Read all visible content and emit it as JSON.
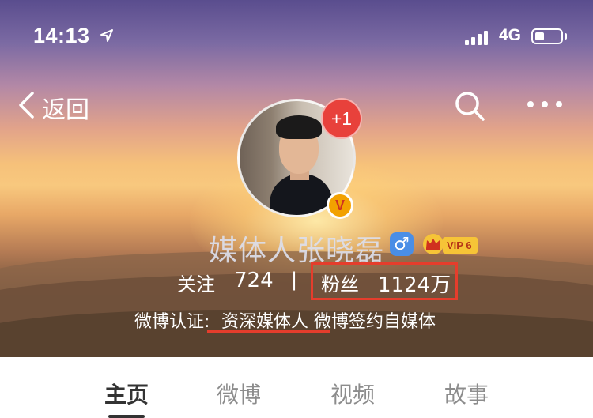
{
  "status_bar": {
    "time": "14:13",
    "network": "4G",
    "signal_bars": 4,
    "battery_level": 0.35,
    "icons": [
      "location-arrow-icon",
      "signal-icon",
      "battery-icon"
    ]
  },
  "nav": {
    "back_label": "返回",
    "icons": [
      "chevron-left-icon",
      "search-icon",
      "more-icon"
    ]
  },
  "profile": {
    "notification_badge": "+1",
    "verified_badge": "V",
    "username": "媒体人张晓磊",
    "gender_symbol": "♂",
    "vip_label": "VIP 6",
    "follow_label": "关注",
    "follow_count": "724",
    "divider": "|",
    "fans_label": "粉丝",
    "fans_count": "1124万",
    "cert_label": "微博认证:",
    "cert_value": "资深媒体人 微博签约自媒体"
  },
  "tabs": [
    {
      "label": "主页",
      "active": true
    },
    {
      "label": "微博",
      "active": false
    },
    {
      "label": "视频",
      "active": false
    },
    {
      "label": "故事",
      "active": false
    }
  ],
  "colors": {
    "highlight_red": "#e53d2c",
    "badge_red": "#e8413b",
    "gender_blue": "#4a8ee6",
    "vip_gold": "#f6c437"
  }
}
